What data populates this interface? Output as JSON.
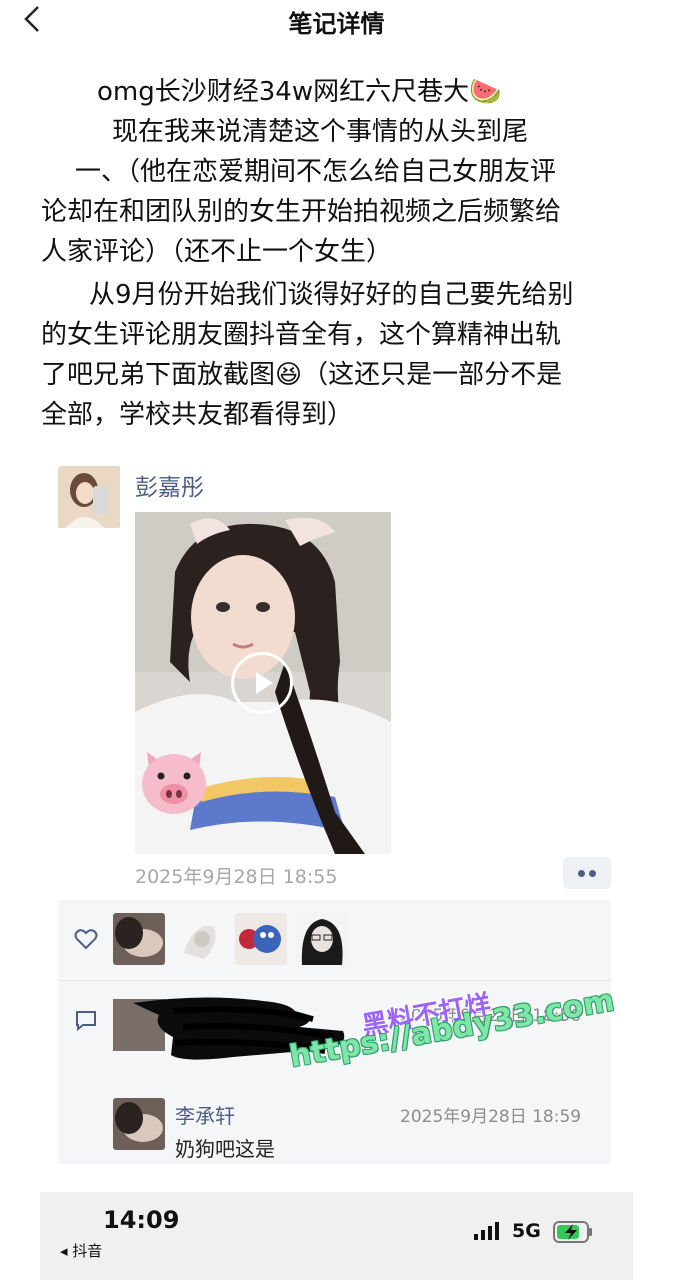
{
  "header": {
    "title": "笔记详情"
  },
  "note": {
    "lines": [
      "omg长沙财经34w网红六尺巷大",
      "现在我来说清楚这个事情的从头到尾",
      "一、（他在恋爱期间不怎么给自己女朋友评",
      "论却在和团队别的女生开始拍视频之后频繁给",
      "人家评论）（还不止一个女生）",
      "从9月份开始我们谈得好好的自己要先给别",
      "的女生评论朋友圈抖音全有，这个算精神出轨",
      "了吧兄弟下面放截图",
      "（这还只是一部分不是",
      "全部，学校共友都看得到）"
    ],
    "emoji_watermelon": "🍉",
    "emoji_laugh": "😆"
  },
  "moment": {
    "username": "彭嘉彤",
    "timestamp": "2025年9月28日 18:55",
    "video_emoji": "🐷",
    "comments": [
      {
        "name": "",
        "time": "2025年9月28日 18:56",
        "text": ""
      },
      {
        "name": "李承轩",
        "time": "2025年9月28日 18:59",
        "text": "奶狗吧这是"
      }
    ]
  },
  "watermark": {
    "line1": "黑料不打烊",
    "line2": "https://abdy33.com"
  },
  "statusbar": {
    "time": "14:09",
    "back_app": "◂ 抖音",
    "network": "5G"
  },
  "colors": {
    "link_blue": "#4e5d86",
    "timestamp_gray": "#a7a7a7",
    "panel_bg": "#f5f6f8",
    "watermark_purple": "#9b64ff",
    "watermark_green": "#7fe6a8"
  }
}
